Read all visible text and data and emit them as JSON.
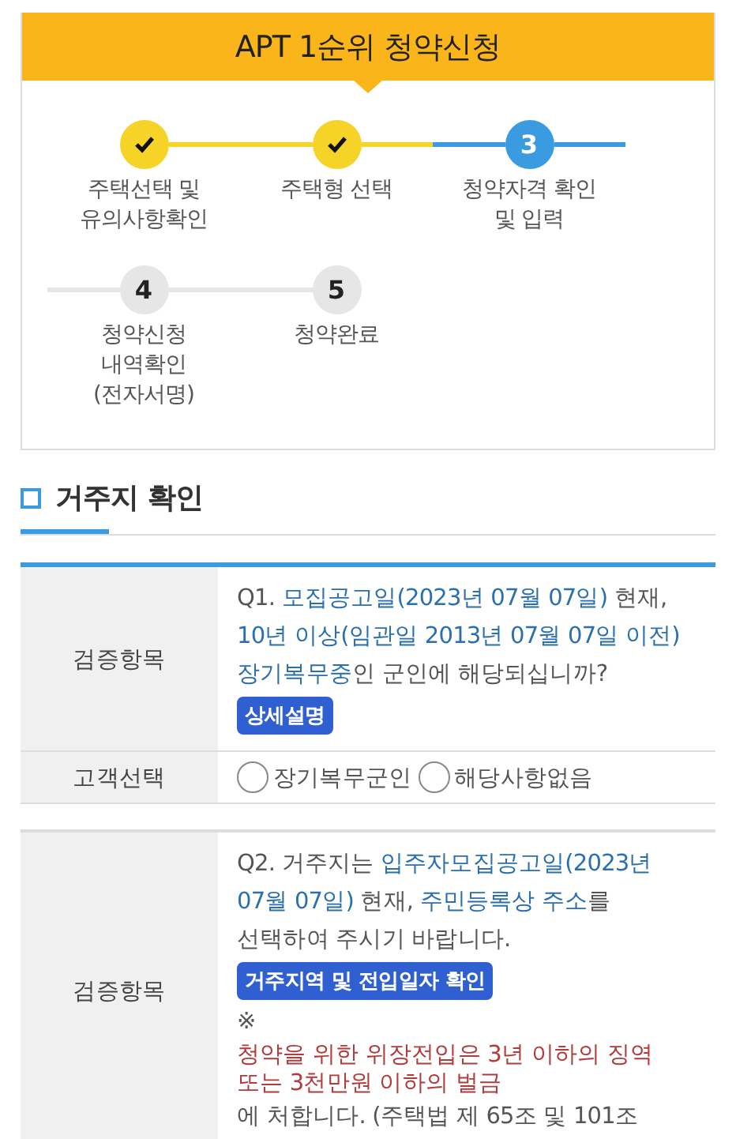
{
  "header": {
    "title": "APT 1순위 청약신청"
  },
  "steps": [
    {
      "label": "주택선택 및\n유의사항확인",
      "completed": true,
      "selected": false
    },
    {
      "label": "주택형 선택",
      "completed": true,
      "selected": false
    },
    {
      "number": "3",
      "label": "청약자격 확인\n및 입력",
      "completed": false,
      "selected": true
    },
    {
      "number": "4",
      "label": "청약신청\n내역확인\n(전자서명)",
      "completed": false,
      "selected": false
    },
    {
      "number": "5",
      "label": "청약완료",
      "completed": false,
      "selected": false
    }
  ],
  "section": {
    "title": "거주지 확인"
  },
  "tables": [
    {
      "accent": true,
      "rows": [
        {
          "kind": "question",
          "label": "검증항목",
          "segments": [
            {
              "text": "Q1. ",
              "kind": "plain"
            },
            {
              "text": "모집공고일(2023년 07월 07일)",
              "kind": "link"
            },
            {
              "text": " 현재,\n",
              "kind": "plain"
            },
            {
              "text": "10년 이상(임관일 2013년 07월 07일 이전)\n",
              "kind": "link"
            },
            {
              "text": "장기복무중",
              "kind": "link"
            },
            {
              "text": "인 군인에 해당되십니까?",
              "kind": "plain"
            }
          ],
          "button": "상세설명"
        },
        {
          "kind": "choice",
          "label": "고객선택",
          "options": [
            {
              "label": "장기복무군인",
              "selected": false
            },
            {
              "label": "해당사항없음",
              "selected": false
            }
          ]
        }
      ]
    },
    {
      "accent": false,
      "rows": [
        {
          "kind": "question",
          "label": "검증항목",
          "segments": [
            {
              "text": "Q2. 거주지는 ",
              "kind": "plain"
            },
            {
              "text": "입주자모집공고일(2023년\n07월 07일)",
              "kind": "link"
            },
            {
              "text": " 현재, ",
              "kind": "plain"
            },
            {
              "text": "주민등록상 주소",
              "kind": "link"
            },
            {
              "text": "를\n선택하여 주시기 바랍니다.",
              "kind": "plain"
            }
          ],
          "button": "거주지역 및 전입일자 확인",
          "notes": [
            {
              "text": "※",
              "kind": "plain"
            },
            {
              "text": "청약을 위한 위장전입은 3년 이하의 징역\n또는 3천만원 이하의 벌금",
              "kind": "warn"
            },
            {
              "text": "에 처합니다. (주택법 제 65조 및 101조",
              "kind": "plain"
            }
          ]
        }
      ]
    }
  ]
}
